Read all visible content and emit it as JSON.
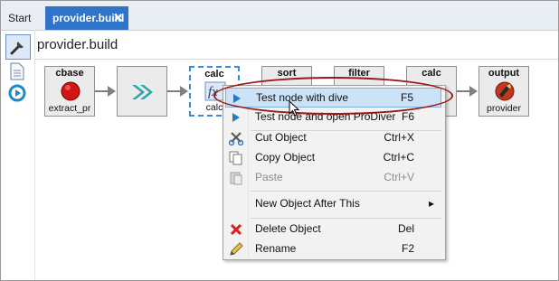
{
  "tabs": [
    {
      "label": "Start"
    },
    {
      "label": "provider.build",
      "close": "✕"
    }
  ],
  "page_title": "provider.build",
  "nodes": [
    {
      "title": "cbase",
      "subtitle": "extract_pr",
      "icon": "red-record-icon"
    },
    {
      "title": "",
      "subtitle": "",
      "icon": "teal-chevrons-icon"
    },
    {
      "title": "calc",
      "subtitle": "calc",
      "icon": "function-icon"
    },
    {
      "title": "sort",
      "subtitle": "",
      "icon": "sort-icon"
    },
    {
      "title": "filter",
      "subtitle": "",
      "icon": "filter-icon"
    },
    {
      "title": "calc",
      "subtitle": "",
      "icon": "function-icon"
    },
    {
      "title": "output",
      "subtitle": "provider",
      "icon": "output-icon"
    }
  ],
  "context_menu": {
    "items": [
      {
        "label": "Test node with dive",
        "shortcut": "F5",
        "icon": "play-arrow-icon"
      },
      {
        "label": "Test node and open ProDiver",
        "shortcut": "F6",
        "icon": "play-arrow-icon"
      },
      {
        "label": "Cut Object",
        "shortcut": "Ctrl+X",
        "icon": "scissors-icon"
      },
      {
        "label": "Copy Object",
        "shortcut": "Ctrl+C",
        "icon": "copy-icon"
      },
      {
        "label": "Paste",
        "shortcut": "Ctrl+V",
        "icon": "paste-icon"
      },
      {
        "label": "New Object After This",
        "submenu": "▸"
      },
      {
        "label": "Delete Object",
        "shortcut": "Del",
        "icon": "red-x-icon"
      },
      {
        "label": "Rename",
        "shortcut": "F2",
        "icon": "pencil-icon"
      }
    ]
  },
  "colors": {
    "active_tab": "#2f74c8",
    "highlight": "#cce3f7",
    "annotation": "#9b1818"
  }
}
